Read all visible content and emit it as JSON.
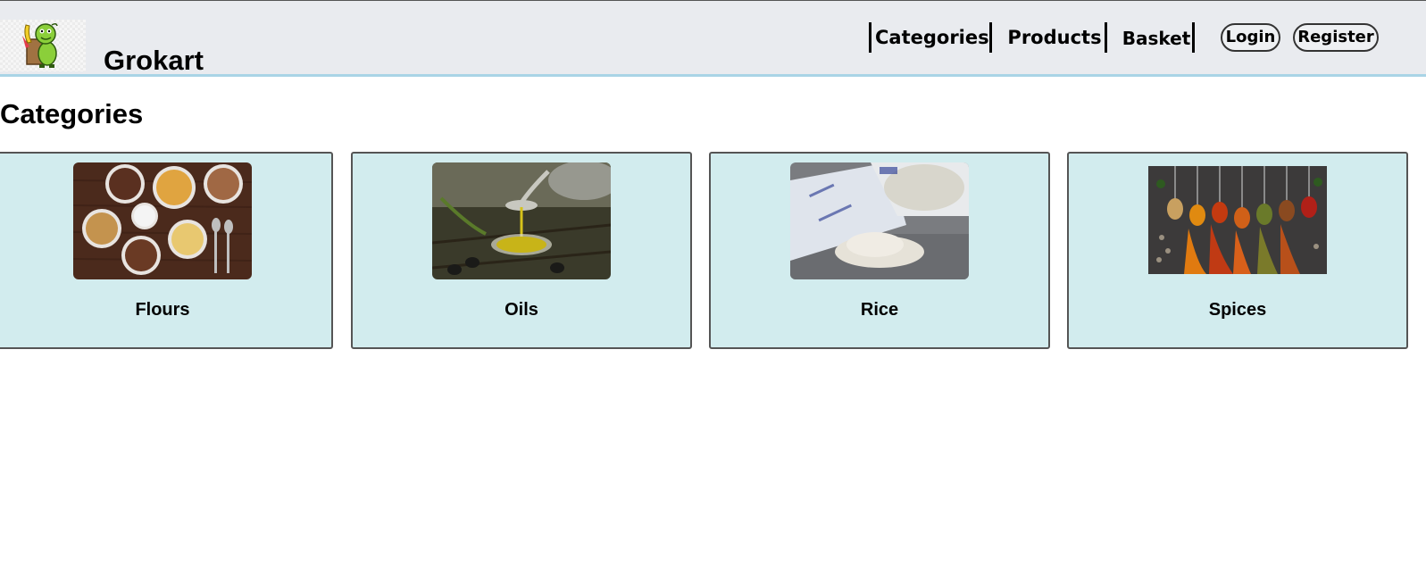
{
  "header": {
    "brand": "Grokart",
    "nav": [
      {
        "label": "Categories"
      },
      {
        "label": "Products"
      },
      {
        "label": "Basket"
      }
    ],
    "login_label": "Login",
    "register_label": "Register",
    "accent_color": "#a9d4e6",
    "background_color": "#e9ebef"
  },
  "main": {
    "title": "Categories",
    "card_color": "#d2ecee",
    "categories": [
      {
        "label": "Flours",
        "image": "cereal-bowls-image"
      },
      {
        "label": "Oils",
        "image": "olive-oil-image"
      },
      {
        "label": "Rice",
        "image": "salt-bag-image"
      },
      {
        "label": "Spices",
        "image": "spice-spoons-image"
      }
    ]
  }
}
